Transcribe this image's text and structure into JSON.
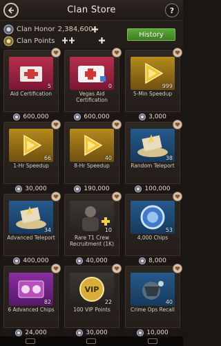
{
  "header": {
    "title": "Clan Store",
    "help_label": "?"
  },
  "stats": {
    "honor_label": "Clan Honor",
    "honor_value": "2,384,600",
    "points_label": "Clan Points",
    "history_label": "History"
  },
  "items": [
    {
      "name": "Aid Certification",
      "qty": "5",
      "price": "600,000",
      "art": "red-aid-kit"
    },
    {
      "name": "Vegas Aid Certification",
      "qty": "0",
      "price": "600,000",
      "art": "white-aid-kit"
    },
    {
      "name": "5-Min Speedup",
      "qty": "999",
      "price": "3,000",
      "art": "speedup"
    },
    {
      "name": "1-Hr Speedup",
      "qty": "66",
      "price": "30,000",
      "art": "speedup"
    },
    {
      "name": "8-Hr Speedup",
      "qty": "40",
      "price": "190,000",
      "art": "speedup"
    },
    {
      "name": "Random Teleport",
      "qty": "38",
      "price": "100,000",
      "art": "teleport"
    },
    {
      "name": "Advanced Teleport",
      "qty": "34",
      "price": "400,000",
      "art": "teleport"
    },
    {
      "name": "Rare T1 Crew Recruitment (1K)",
      "qty": "10",
      "price": "40,000",
      "art": "crew"
    },
    {
      "name": "4,000 Chips",
      "qty": "53",
      "price": "8,000",
      "art": "chip"
    },
    {
      "name": "6 Advanced Chips",
      "qty": "82",
      "price": "24,000",
      "art": "advanced-chips"
    },
    {
      "name": "100 VIP Points",
      "qty": "22",
      "price": "30,000",
      "art": "vip"
    },
    {
      "name": "Crime Ops Recall",
      "qty": "40",
      "price": "10,000",
      "art": "recall"
    }
  ]
}
